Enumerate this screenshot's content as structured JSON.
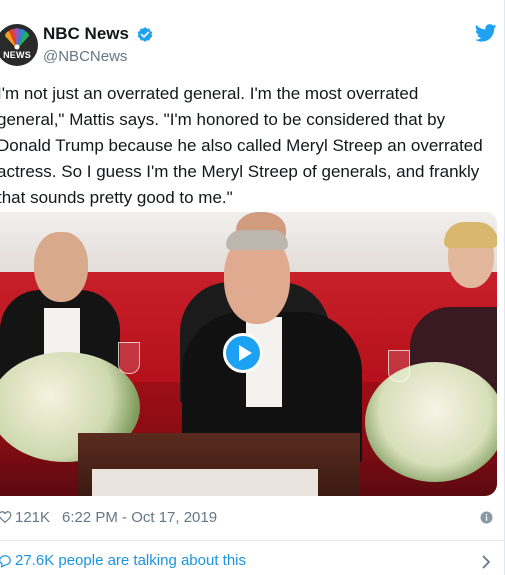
{
  "account": {
    "name": "NBC News",
    "handle": "@NBCNews",
    "avatar_text": "NEWS",
    "verified": true
  },
  "tweet": {
    "lines": [
      "I'm not just an overrated general. I'm the most overrated",
      "general,\" Mattis says. \"I'm honored to be considered that by",
      "Donald Trump because he also called Meryl Streep an overrated",
      "actress. So I guess I'm the Meryl Streep of generals, and frankly",
      "that sounds pretty good to me.\""
    ]
  },
  "media": {
    "type": "video",
    "play_icon": "play-icon"
  },
  "meta": {
    "likes": "121K",
    "timestamp": "6:22 PM - Oct 17, 2019"
  },
  "conversation": {
    "label": "27.6K people are talking about this"
  },
  "icons": {
    "verified": "verified-badge-icon",
    "brand": "twitter-bird-icon",
    "like": "heart-icon",
    "info": "info-icon",
    "reply": "speech-bubble-icon",
    "more": "chevron-right-icon"
  },
  "colors": {
    "accent": "#1da1f2",
    "link": "#1b95e0",
    "secondary_text": "#657786",
    "text": "#14171a"
  }
}
